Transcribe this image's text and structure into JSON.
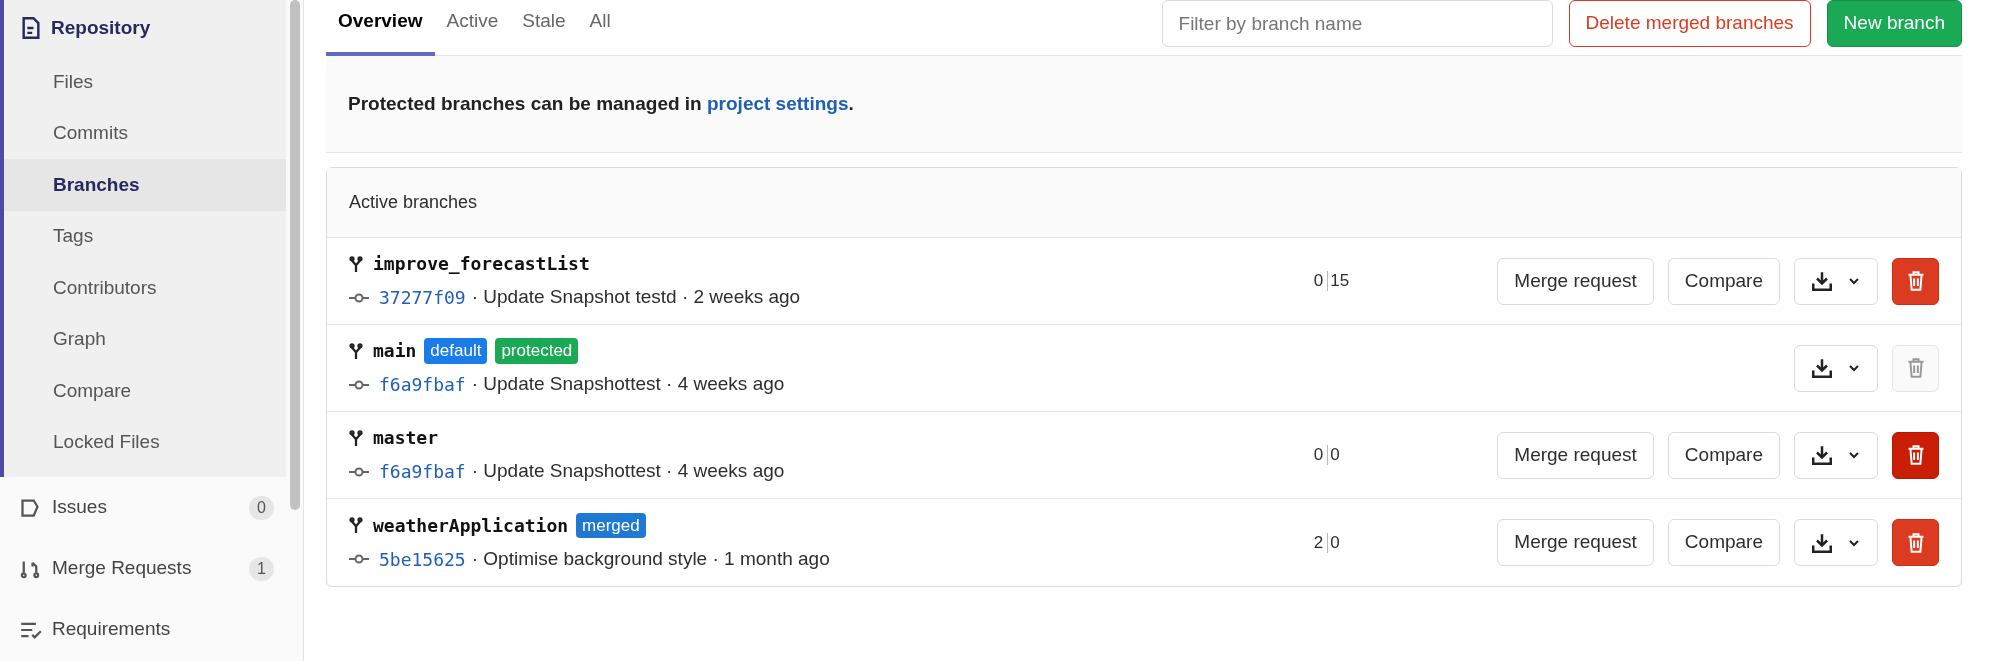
{
  "sidebar": {
    "section": {
      "label": "Repository",
      "expanded": true,
      "items": [
        {
          "label": "Files",
          "selected": false
        },
        {
          "label": "Commits",
          "selected": false
        },
        {
          "label": "Branches",
          "selected": true
        },
        {
          "label": "Tags",
          "selected": false
        },
        {
          "label": "Contributors",
          "selected": false
        },
        {
          "label": "Graph",
          "selected": false
        },
        {
          "label": "Compare",
          "selected": false
        },
        {
          "label": "Locked Files",
          "selected": false
        }
      ]
    },
    "items": [
      {
        "kind": "issues",
        "label": "Issues",
        "count": "0"
      },
      {
        "kind": "merge",
        "label": "Merge Requests",
        "count": "1"
      },
      {
        "kind": "requirements",
        "label": "Requirements"
      }
    ]
  },
  "tabs": [
    {
      "label": "Overview",
      "selected": true
    },
    {
      "label": "Active",
      "selected": false
    },
    {
      "label": "Stale",
      "selected": false
    },
    {
      "label": "All",
      "selected": false
    }
  ],
  "filter": {
    "placeholder": "Filter by branch name"
  },
  "buttons": {
    "delete_merged": "Delete merged branches",
    "new_branch": "New branch"
  },
  "notice": {
    "text": "**Protected branches can be managed in** ",
    "link": "project settings",
    "end": "."
  },
  "card": {
    "title": "Active branches",
    "rows": [
      {
        "name": "improve_forecastList",
        "badges": [],
        "commit": "37277f09",
        "message": "· Update Snapshot testd · 2 weeks ago",
        "divergence": {
          "behind": "0",
          "ahead": "15"
        },
        "merge_request": "Merge request",
        "compare": "Compare",
        "delete": {
          "disabled": false,
          "hovered": false
        }
      },
      {
        "name": "main",
        "badges": [
          {
            "label": "default",
            "color": "#1a7ce8"
          },
          {
            "label": "protected",
            "color": "#1aaa55"
          }
        ],
        "commit": "f6a9fbaf",
        "message": "· Update Snapshottest · 4 weeks ago",
        "delete": {
          "disabled": true
        }
      },
      {
        "name": "master",
        "badges": [],
        "commit": "f6a9fbaf",
        "message": "· Update Snapshottest · 4 weeks ago",
        "divergence": {
          "behind": "0",
          "ahead": "0"
        },
        "merge_request": "Merge request",
        "compare": "Compare",
        "delete": {
          "disabled": false,
          "hovered": true
        }
      },
      {
        "name": "weatherApplication",
        "badges": [
          {
            "label": "merged",
            "color": "#1f78d1"
          }
        ],
        "commit": "5be15625",
        "message": "· Optimise background style · 1 month ago",
        "divergence": {
          "behind": "2",
          "ahead": "0"
        },
        "merge_request": "Merge request",
        "compare": "Compare",
        "delete": {
          "disabled": false,
          "hovered": false
        }
      }
    ]
  }
}
